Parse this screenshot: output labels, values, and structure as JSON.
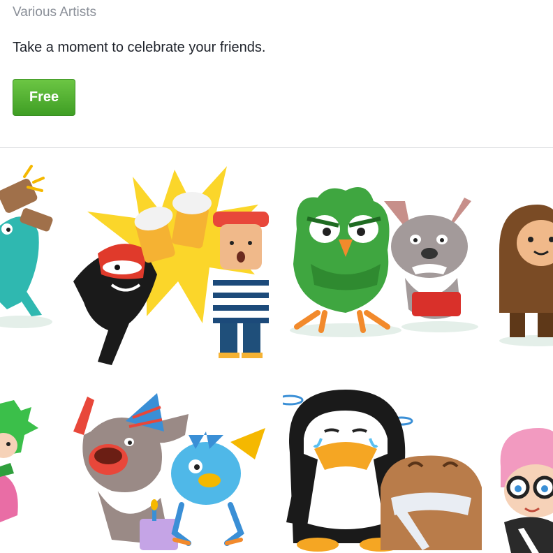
{
  "header": {
    "artist": "Various Artists",
    "description": "Take a moment to celebrate your friends.",
    "free_label": "Free"
  },
  "colors": {
    "button_green": "#4caf2f",
    "artist_gray": "#8a8f98",
    "divider": "#dddfe2"
  },
  "stickers": [
    {
      "name": "teal-creature-dancing"
    },
    {
      "name": "masked-guy-and-sailor-toasting-beers"
    },
    {
      "name": "angry-green-owl-and-bulldog"
    },
    {
      "name": "brown-hairy-creature"
    },
    {
      "name": "green-haired-pink-creature"
    },
    {
      "name": "party-bulldog-and-blue-bird-cake"
    },
    {
      "name": "crying-penguin-and-sad-blob"
    },
    {
      "name": "pink-haired-kid-with-glasses"
    }
  ]
}
